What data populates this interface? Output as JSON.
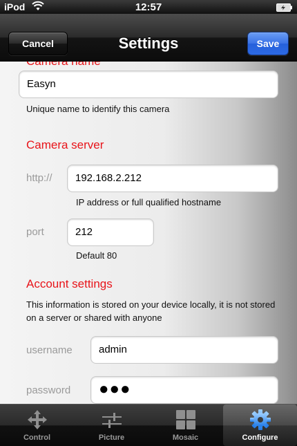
{
  "status_bar": {
    "carrier": "iPod",
    "time": "12:57"
  },
  "navbar": {
    "title": "Settings",
    "cancel_label": "Cancel",
    "save_label": "Save"
  },
  "camera_name": {
    "section_title": "Camera name",
    "value": "Easyn",
    "hint": "Unique name to identify this camera"
  },
  "camera_server": {
    "section_title": "Camera server",
    "http_label": "http://",
    "http_value": "192.168.2.212",
    "http_hint": "IP address or full qualified hostname",
    "port_label": "port",
    "port_value": "212",
    "port_hint": "Default 80"
  },
  "account": {
    "section_title": "Account settings",
    "description": "This information is stored on your device locally, it is not stored on a server or shared with anyone",
    "username_label": "username",
    "username_value": "admin",
    "password_label": "password",
    "password_value": "●●●"
  },
  "tabbar": {
    "active_color": "#ffffff",
    "items": [
      {
        "label": "Control",
        "icon": "move-arrows-icon"
      },
      {
        "label": "Picture",
        "icon": "sliders-icon"
      },
      {
        "label": "Mosaic",
        "icon": "grid-icon"
      },
      {
        "label": "Configure",
        "icon": "gear-icon"
      }
    ]
  }
}
